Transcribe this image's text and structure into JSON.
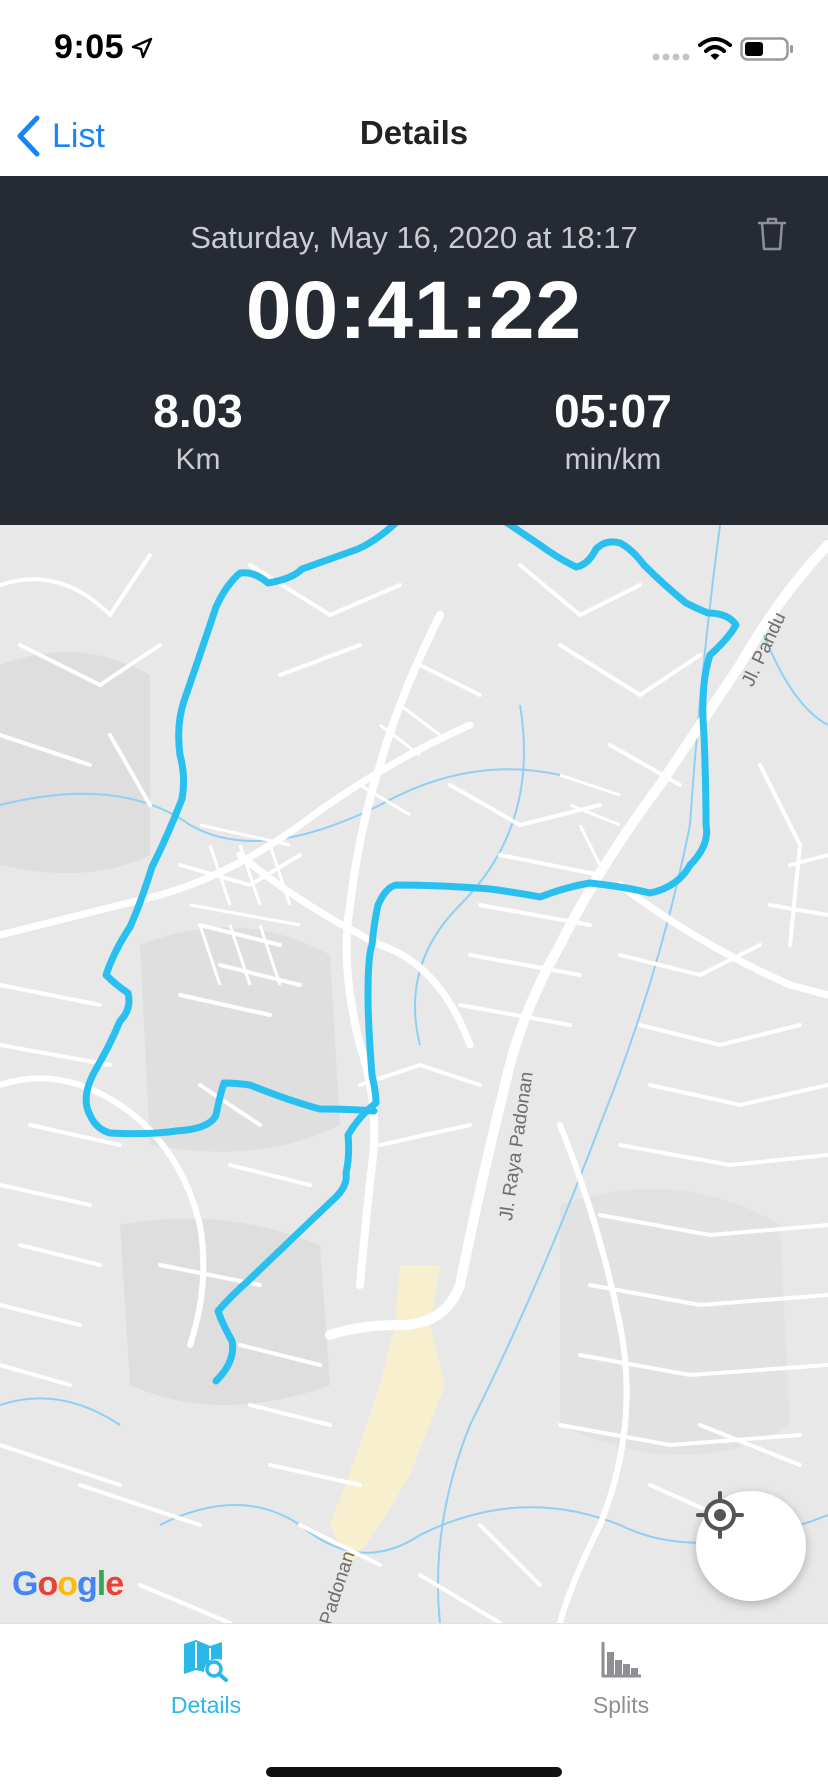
{
  "status_bar": {
    "time": "9:05",
    "icons": [
      "location-arrow-icon",
      "cellular-signal-icon",
      "wifi-icon",
      "battery-icon"
    ]
  },
  "nav": {
    "back_label": "List",
    "title": "Details"
  },
  "summary": {
    "date": "Saturday, May 16, 2020 at 18:17",
    "duration": "00:41:22",
    "distance_value": "8.03",
    "distance_unit": "Km",
    "pace_value": "05:07",
    "pace_unit": "min/km"
  },
  "map": {
    "street_labels": [
      "Jl. Pandu",
      "Jl. Raya Padonan",
      "Padonan"
    ],
    "attribution": "Google",
    "route_color": "#29c0f0"
  },
  "tabs": [
    {
      "label": "Details",
      "icon": "map-search-icon",
      "active": true
    },
    {
      "label": "Splits",
      "icon": "bar-chart-icon",
      "active": false
    }
  ],
  "colors": {
    "accent": "#1a84f5",
    "tab_active": "#2ab8ea",
    "tab_inactive": "#8e8e93",
    "summary_bg": "#262a33"
  }
}
